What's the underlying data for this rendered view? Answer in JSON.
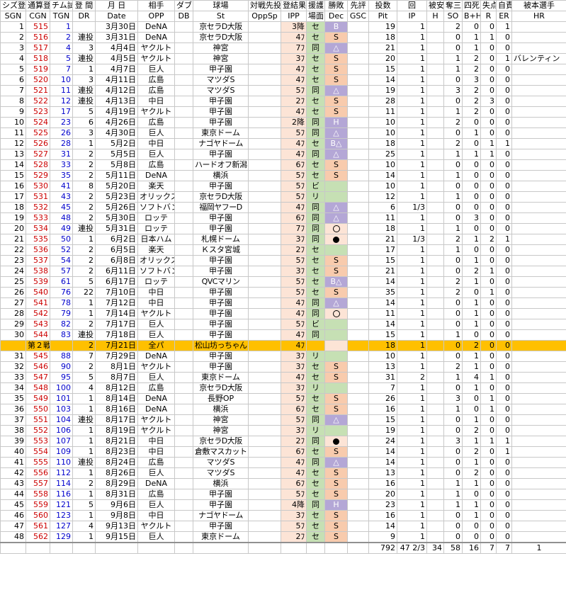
{
  "headers_jp": [
    "シズ登",
    "通算登",
    "チム試",
    "登 間",
    "月 日",
    "相手",
    "ダブル",
    "球場",
    "対戦先投",
    "登結果",
    "援護",
    "勝敗",
    "先評",
    "投数",
    "回",
    "被安",
    "奪三",
    "四死",
    "失点",
    "自責",
    "被本選手"
  ],
  "headers_en": [
    "SGN",
    "CGN",
    "TGN",
    "DR",
    "Date",
    "OPP",
    "DB",
    "St",
    "OppSp",
    "IPP",
    "場面",
    "Dec",
    "GSC",
    "Pit",
    "IP",
    "H",
    "SO",
    "B+H",
    "R",
    "ER",
    "HR"
  ],
  "rows": [
    {
      "sgn": "1",
      "cgn": "515",
      "tgn": "1",
      "dr": "",
      "date": "3月30日",
      "opp": "DeNA",
      "st": "京セラD大阪",
      "ipp": "3降",
      "scene": "セ",
      "dec": "B",
      "pit": "19",
      "ip": "1",
      "h": "",
      "so": "2",
      "bh": "0",
      "r": "0",
      "er": "1",
      "hr": ""
    },
    {
      "sgn": "2",
      "cgn": "516",
      "tgn": "2",
      "dr": "連投",
      "date": "3月31日",
      "opp": "DeNA",
      "st": "京セラD大阪",
      "ipp": "4ﾌ",
      "scene": "セ",
      "dec": "S",
      "pit": "18",
      "ip": "1",
      "h": "",
      "so": "0",
      "bh": "1",
      "r": "1",
      "er": "0",
      "hr": ""
    },
    {
      "sgn": "3",
      "cgn": "517",
      "tgn": "4",
      "dr": "3",
      "date": "4月4日",
      "opp": "ヤクルト",
      "st": "神宮",
      "ipp": "7ﾌ",
      "scene": "同",
      "dec": "△",
      "pit": "21",
      "ip": "1",
      "h": "",
      "so": "0",
      "bh": "1",
      "r": "0",
      "er": "0",
      "hr": ""
    },
    {
      "sgn": "4",
      "cgn": "518",
      "tgn": "5",
      "dr": "連投",
      "date": "4月5日",
      "opp": "ヤクルト",
      "st": "神宮",
      "ipp": "3ﾌ",
      "scene": "セ",
      "dec": "S",
      "pit": "20",
      "ip": "1",
      "h": "",
      "so": "1",
      "bh": "2",
      "r": "0",
      "er": "1",
      "hr": "バレンティン"
    },
    {
      "sgn": "5",
      "cgn": "519",
      "tgn": "7",
      "dr": "1",
      "date": "4月7日",
      "opp": "巨人",
      "st": "甲子園",
      "ipp": "4ﾌ",
      "scene": "セ",
      "dec": "S",
      "pit": "15",
      "ip": "1",
      "h": "",
      "so": "1",
      "bh": "2",
      "r": "0",
      "er": "0",
      "hr": ""
    },
    {
      "sgn": "6",
      "cgn": "520",
      "tgn": "10",
      "dr": "3",
      "date": "4月11日",
      "opp": "広島",
      "st": "マツダS",
      "ipp": "4ﾌ",
      "scene": "セ",
      "dec": "S",
      "pit": "14",
      "ip": "1",
      "h": "",
      "so": "0",
      "bh": "3",
      "r": "0",
      "er": "0",
      "hr": ""
    },
    {
      "sgn": "7",
      "cgn": "521",
      "tgn": "11",
      "dr": "連投",
      "date": "4月12日",
      "opp": "広島",
      "st": "マツダS",
      "ipp": "5ﾌ",
      "scene": "同",
      "dec": "△",
      "pit": "19",
      "ip": "1",
      "h": "",
      "so": "3",
      "bh": "2",
      "r": "0",
      "er": "0",
      "hr": ""
    },
    {
      "sgn": "8",
      "cgn": "522",
      "tgn": "12",
      "dr": "連投",
      "date": "4月13日",
      "opp": "中日",
      "st": "甲子園",
      "ipp": "2ﾌ",
      "scene": "セ",
      "dec": "S",
      "pit": "28",
      "ip": "1",
      "h": "",
      "so": "0",
      "bh": "2",
      "r": "3",
      "er": "0",
      "hr": ""
    },
    {
      "sgn": "9",
      "cgn": "523",
      "tgn": "17",
      "dr": "5",
      "date": "4月19日",
      "opp": "ヤクルト",
      "st": "甲子園",
      "ipp": "4ﾌ",
      "scene": "セ",
      "dec": "S",
      "pit": "11",
      "ip": "1",
      "h": "",
      "so": "1",
      "bh": "2",
      "r": "0",
      "er": "0",
      "hr": ""
    },
    {
      "sgn": "10",
      "cgn": "524",
      "tgn": "23",
      "dr": "6",
      "date": "4月26日",
      "opp": "広島",
      "st": "甲子園",
      "ipp": "2降",
      "scene": "同",
      "dec": "H",
      "pit": "10",
      "ip": "1",
      "h": "",
      "so": "2",
      "bh": "0",
      "r": "0",
      "er": "0",
      "hr": ""
    },
    {
      "sgn": "11",
      "cgn": "525",
      "tgn": "26",
      "dr": "3",
      "date": "4月30日",
      "opp": "巨人",
      "st": "東京ドーム",
      "ipp": "5ﾌ",
      "scene": "同",
      "dec": "△",
      "pit": "10",
      "ip": "1",
      "h": "",
      "so": "0",
      "bh": "1",
      "r": "0",
      "er": "0",
      "hr": ""
    },
    {
      "sgn": "12",
      "cgn": "526",
      "tgn": "28",
      "dr": "1",
      "date": "5月2日",
      "opp": "中日",
      "st": "ナゴヤドーム",
      "ipp": "4ﾌ",
      "scene": "セ",
      "dec": "B△",
      "pit": "18",
      "ip": "1",
      "h": "",
      "so": "2",
      "bh": "0",
      "r": "1",
      "er": "1",
      "hr": ""
    },
    {
      "sgn": "13",
      "cgn": "527",
      "tgn": "31",
      "dr": "2",
      "date": "5月5日",
      "opp": "巨人",
      "st": "甲子園",
      "ipp": "4ﾌ",
      "scene": "同",
      "dec": "△",
      "pit": "25",
      "ip": "1",
      "h": "",
      "so": "1",
      "bh": "1",
      "r": "1",
      "er": "0",
      "hr": ""
    },
    {
      "sgn": "14",
      "cgn": "528",
      "tgn": "33",
      "dr": "2",
      "date": "5月8日",
      "opp": "広島",
      "st": "ハードオフ新潟",
      "ipp": "6ﾌ",
      "scene": "セ",
      "dec": "S",
      "pit": "10",
      "ip": "1",
      "h": "",
      "so": "0",
      "bh": "0",
      "r": "0",
      "er": "0",
      "hr": ""
    },
    {
      "sgn": "15",
      "cgn": "529",
      "tgn": "35",
      "dr": "2",
      "date": "5月11日",
      "opp": "DeNA",
      "st": "横浜",
      "ipp": "5ﾌ",
      "scene": "セ",
      "dec": "S",
      "pit": "14",
      "ip": "1",
      "h": "",
      "so": "1",
      "bh": "0",
      "r": "0",
      "er": "0",
      "hr": ""
    },
    {
      "sgn": "16",
      "cgn": "530",
      "tgn": "41",
      "dr": "8",
      "date": "5月20日",
      "opp": "楽天",
      "st": "甲子園",
      "ipp": "5ﾌ",
      "scene": "ビ",
      "dec": "",
      "pit": "10",
      "ip": "1",
      "h": "",
      "so": "0",
      "bh": "0",
      "r": "0",
      "er": "0",
      "hr": ""
    },
    {
      "sgn": "17",
      "cgn": "531",
      "tgn": "43",
      "dr": "2",
      "date": "5月23日",
      "opp": "オリックス",
      "st": "京セラD大阪",
      "ipp": "5ﾌ",
      "scene": "リ",
      "dec": "",
      "pit": "12",
      "ip": "1",
      "h": "",
      "so": "1",
      "bh": "0",
      "r": "0",
      "er": "0",
      "hr": ""
    },
    {
      "sgn": "18",
      "cgn": "532",
      "tgn": "45",
      "dr": "2",
      "date": "5月26日",
      "opp": "ソフトバンク",
      "st": "福岡ヤフーD",
      "ipp": "4ﾌ",
      "scene": "同",
      "dec": "△",
      "pit": "6",
      "ip": "1/3",
      "h": "",
      "so": "0",
      "bh": "0",
      "r": "0",
      "er": "0",
      "hr": ""
    },
    {
      "sgn": "19",
      "cgn": "533",
      "tgn": "48",
      "dr": "2",
      "date": "5月30日",
      "opp": "ロッテ",
      "st": "甲子園",
      "ipp": "6ﾌ",
      "scene": "同",
      "dec": "△",
      "pit": "11",
      "ip": "1",
      "h": "",
      "so": "0",
      "bh": "3",
      "r": "0",
      "er": "0",
      "hr": ""
    },
    {
      "sgn": "20",
      "cgn": "534",
      "tgn": "49",
      "dr": "連投",
      "date": "5月31日",
      "opp": "ロッテ",
      "st": "甲子園",
      "ipp": "7ﾌ",
      "scene": "同",
      "dec": "○",
      "pit": "18",
      "ip": "1",
      "h": "",
      "so": "1",
      "bh": "0",
      "r": "0",
      "er": "0",
      "hr": ""
    },
    {
      "sgn": "21",
      "cgn": "535",
      "tgn": "50",
      "dr": "1",
      "date": "6月2日",
      "opp": "日本ハム",
      "st": "札幌ドーム",
      "ipp": "3ﾌ",
      "scene": "同",
      "dec": "●",
      "pit": "21",
      "ip": "1/3",
      "h": "",
      "so": "2",
      "bh": "1",
      "r": "2",
      "er": "1",
      "hr": ""
    },
    {
      "sgn": "22",
      "cgn": "536",
      "tgn": "52",
      "dr": "2",
      "date": "6月5日",
      "opp": "楽天",
      "st": "Ｋスタ宮城",
      "ipp": "2ﾌ",
      "scene": "セ",
      "dec": "",
      "pit": "17",
      "ip": "1",
      "h": "",
      "so": "1",
      "bh": "0",
      "r": "0",
      "er": "0",
      "hr": ""
    },
    {
      "sgn": "23",
      "cgn": "537",
      "tgn": "54",
      "dr": "2",
      "date": "6月8日",
      "opp": "オリックス",
      "st": "甲子園",
      "ipp": "5ﾌ",
      "scene": "セ",
      "dec": "S",
      "pit": "15",
      "ip": "1",
      "h": "",
      "so": "0",
      "bh": "1",
      "r": "0",
      "er": "0",
      "hr": ""
    },
    {
      "sgn": "24",
      "cgn": "538",
      "tgn": "57",
      "dr": "2",
      "date": "6月11日",
      "opp": "ソフトバンク",
      "st": "甲子園",
      "ipp": "3ﾌ",
      "scene": "セ",
      "dec": "S",
      "pit": "21",
      "ip": "1",
      "h": "",
      "so": "0",
      "bh": "2",
      "r": "1",
      "er": "0",
      "hr": ""
    },
    {
      "sgn": "25",
      "cgn": "539",
      "tgn": "61",
      "dr": "5",
      "date": "6月17日",
      "opp": "ロッテ",
      "st": "QVCマリン",
      "ipp": "5ﾌ",
      "scene": "セ",
      "dec": "B△",
      "pit": "14",
      "ip": "1",
      "h": "",
      "so": "2",
      "bh": "1",
      "r": "0",
      "er": "0",
      "hr": ""
    },
    {
      "sgn": "26",
      "cgn": "540",
      "tgn": "76",
      "dr": "22",
      "date": "7月10日",
      "opp": "中日",
      "st": "甲子園",
      "ipp": "5ﾌ",
      "scene": "セ",
      "dec": "S",
      "pit": "35",
      "ip": "1",
      "h": "",
      "so": "2",
      "bh": "0",
      "r": "1",
      "er": "0",
      "hr": ""
    },
    {
      "sgn": "27",
      "cgn": "541",
      "tgn": "78",
      "dr": "1",
      "date": "7月12日",
      "opp": "中日",
      "st": "甲子園",
      "ipp": "4ﾌ",
      "scene": "同",
      "dec": "△",
      "pit": "14",
      "ip": "1",
      "h": "",
      "so": "0",
      "bh": "1",
      "r": "0",
      "er": "0",
      "hr": ""
    },
    {
      "sgn": "28",
      "cgn": "542",
      "tgn": "79",
      "dr": "1",
      "date": "7月14日",
      "opp": "ヤクルト",
      "st": "甲子園",
      "ipp": "4ﾌ",
      "scene": "同",
      "dec": "○",
      "pit": "11",
      "ip": "1",
      "h": "",
      "so": "0",
      "bh": "1",
      "r": "0",
      "er": "0",
      "hr": ""
    },
    {
      "sgn": "29",
      "cgn": "543",
      "tgn": "82",
      "dr": "2",
      "date": "7月17日",
      "opp": "巨人",
      "st": "甲子園",
      "ipp": "5ﾌ",
      "scene": "ビ",
      "dec": "",
      "pit": "14",
      "ip": "1",
      "h": "",
      "so": "0",
      "bh": "1",
      "r": "0",
      "er": "0",
      "hr": ""
    },
    {
      "sgn": "30",
      "cgn": "544",
      "tgn": "83",
      "dr": "連投",
      "date": "7月18日",
      "opp": "巨人",
      "st": "甲子園",
      "ipp": "4ﾌ",
      "scene": "同",
      "dec": "",
      "pit": "15",
      "ip": "1",
      "h": "",
      "so": "1",
      "bh": "0",
      "r": "0",
      "er": "0",
      "hr": ""
    }
  ],
  "special_row": {
    "label": "第２戦",
    "tgn": "",
    "dr": "2",
    "date": "7月21日",
    "opp": "全パ",
    "st": "松山坊っちゃん",
    "ipp": "4ﾌ",
    "pit": "18",
    "ip": "1",
    "h": "",
    "so": "0",
    "bh": "2",
    "r": "0",
    "er": "0"
  },
  "rows2": [
    {
      "sgn": "31",
      "cgn": "545",
      "tgn": "88",
      "dr": "7",
      "date": "7月29日",
      "opp": "DeNA",
      "st": "甲子園",
      "ipp": "3ﾌ",
      "scene": "リ",
      "dec": "",
      "pit": "10",
      "ip": "1",
      "h": "",
      "so": "0",
      "bh": "1",
      "r": "0",
      "er": "0",
      "hr": ""
    },
    {
      "sgn": "32",
      "cgn": "546",
      "tgn": "90",
      "dr": "2",
      "date": "8月1日",
      "opp": "ヤクルト",
      "st": "甲子園",
      "ipp": "3ﾌ",
      "scene": "セ",
      "dec": "S",
      "pit": "13",
      "ip": "1",
      "h": "",
      "so": "2",
      "bh": "1",
      "r": "0",
      "er": "0",
      "hr": ""
    },
    {
      "sgn": "33",
      "cgn": "547",
      "tgn": "95",
      "dr": "5",
      "date": "8月7日",
      "opp": "巨人",
      "st": "東京ドーム",
      "ipp": "4ﾌ",
      "scene": "セ",
      "dec": "S",
      "pit": "31",
      "ip": "2",
      "h": "",
      "so": "1",
      "bh": "4",
      "r": "1",
      "er": "0",
      "hr": ""
    },
    {
      "sgn": "34",
      "cgn": "548",
      "tgn": "100",
      "dr": "4",
      "date": "8月12日",
      "opp": "広島",
      "st": "京セラD大阪",
      "ipp": "3ﾌ",
      "scene": "リ",
      "dec": "",
      "pit": "7",
      "ip": "1",
      "h": "",
      "so": "0",
      "bh": "1",
      "r": "0",
      "er": "0",
      "hr": ""
    },
    {
      "sgn": "35",
      "cgn": "549",
      "tgn": "101",
      "dr": "1",
      "date": "8月14日",
      "opp": "DeNA",
      "st": "長野OP",
      "ipp": "5ﾌ",
      "scene": "セ",
      "dec": "S",
      "pit": "26",
      "ip": "1",
      "h": "",
      "so": "3",
      "bh": "0",
      "r": "1",
      "er": "0",
      "hr": ""
    },
    {
      "sgn": "36",
      "cgn": "550",
      "tgn": "103",
      "dr": "1",
      "date": "8月16日",
      "opp": "DeNA",
      "st": "横浜",
      "ipp": "6ﾌ",
      "scene": "セ",
      "dec": "S",
      "pit": "16",
      "ip": "1",
      "h": "",
      "so": "1",
      "bh": "0",
      "r": "1",
      "er": "0",
      "hr": ""
    },
    {
      "sgn": "37",
      "cgn": "551",
      "tgn": "104",
      "dr": "連投",
      "date": "8月17日",
      "opp": "ヤクルト",
      "st": "神宮",
      "ipp": "5ﾌ",
      "scene": "同",
      "dec": "△",
      "pit": "15",
      "ip": "1",
      "h": "",
      "so": "0",
      "bh": "1",
      "r": "0",
      "er": "0",
      "hr": ""
    },
    {
      "sgn": "38",
      "cgn": "552",
      "tgn": "106",
      "dr": "1",
      "date": "8月19日",
      "opp": "ヤクルト",
      "st": "神宮",
      "ipp": "3ﾌ",
      "scene": "リ",
      "dec": "",
      "pit": "19",
      "ip": "1",
      "h": "",
      "so": "0",
      "bh": "2",
      "r": "0",
      "er": "0",
      "hr": ""
    },
    {
      "sgn": "39",
      "cgn": "553",
      "tgn": "107",
      "dr": "1",
      "date": "8月21日",
      "opp": "中日",
      "st": "京セラD大阪",
      "ipp": "2ﾌ",
      "scene": "同",
      "dec": "●",
      "pit": "24",
      "ip": "1",
      "h": "",
      "so": "3",
      "bh": "1",
      "r": "1",
      "er": "1",
      "hr": ""
    },
    {
      "sgn": "40",
      "cgn": "554",
      "tgn": "109",
      "dr": "1",
      "date": "8月23日",
      "opp": "中日",
      "st": "倉敷マスカット",
      "ipp": "6ﾌ",
      "scene": "セ",
      "dec": "S",
      "pit": "14",
      "ip": "1",
      "h": "",
      "so": "0",
      "bh": "2",
      "r": "0",
      "er": "1",
      "hr": ""
    },
    {
      "sgn": "41",
      "cgn": "555",
      "tgn": "110",
      "dr": "連投",
      "date": "8月24日",
      "opp": "広島",
      "st": "マツダS",
      "ipp": "4ﾌ",
      "scene": "同",
      "dec": "△",
      "pit": "14",
      "ip": "1",
      "h": "",
      "so": "0",
      "bh": "1",
      "r": "0",
      "er": "0",
      "hr": ""
    },
    {
      "sgn": "42",
      "cgn": "556",
      "tgn": "112",
      "dr": "1",
      "date": "8月26日",
      "opp": "巨人",
      "st": "マツダS",
      "ipp": "4ﾌ",
      "scene": "セ",
      "dec": "S",
      "pit": "13",
      "ip": "1",
      "h": "",
      "so": "0",
      "bh": "2",
      "r": "0",
      "er": "0",
      "hr": ""
    },
    {
      "sgn": "43",
      "cgn": "557",
      "tgn": "114",
      "dr": "2",
      "date": "8月29日",
      "opp": "DeNA",
      "st": "横浜",
      "ipp": "6ﾌ",
      "scene": "セ",
      "dec": "S",
      "pit": "16",
      "ip": "1",
      "h": "",
      "so": "1",
      "bh": "1",
      "r": "0",
      "er": "0",
      "hr": ""
    },
    {
      "sgn": "44",
      "cgn": "558",
      "tgn": "116",
      "dr": "1",
      "date": "8月31日",
      "opp": "広島",
      "st": "甲子園",
      "ipp": "5ﾌ",
      "scene": "セ",
      "dec": "S",
      "pit": "20",
      "ip": "1",
      "h": "",
      "so": "1",
      "bh": "0",
      "r": "0",
      "er": "0",
      "hr": ""
    },
    {
      "sgn": "45",
      "cgn": "559",
      "tgn": "121",
      "dr": "5",
      "date": "9月6日",
      "opp": "巨人",
      "st": "甲子園",
      "ipp": "4降",
      "scene": "同",
      "dec": "H",
      "pit": "23",
      "ip": "1",
      "h": "",
      "so": "1",
      "bh": "1",
      "r": "0",
      "er": "0",
      "hr": ""
    },
    {
      "sgn": "46",
      "cgn": "560",
      "tgn": "123",
      "dr": "1",
      "date": "9月8日",
      "opp": "中日",
      "st": "ナゴヤドーム",
      "ipp": "3ﾌ",
      "scene": "セ",
      "dec": "S",
      "pit": "16",
      "ip": "1",
      "h": "",
      "so": "0",
      "bh": "1",
      "r": "0",
      "er": "0",
      "hr": ""
    },
    {
      "sgn": "47",
      "cgn": "561",
      "tgn": "127",
      "dr": "4",
      "date": "9月13日",
      "opp": "ヤクルト",
      "st": "甲子園",
      "ipp": "5ﾌ",
      "scene": "セ",
      "dec": "S",
      "pit": "14",
      "ip": "1",
      "h": "",
      "so": "0",
      "bh": "0",
      "r": "0",
      "er": "0",
      "hr": ""
    },
    {
      "sgn": "48",
      "cgn": "562",
      "tgn": "129",
      "dr": "1",
      "date": "9月15日",
      "opp": "巨人",
      "st": "東京ドーム",
      "ipp": "2ﾌ",
      "scene": "セ",
      "dec": "S",
      "pit": "9",
      "ip": "1",
      "h": "",
      "so": "0",
      "bh": "0",
      "r": "0",
      "er": "0",
      "hr": ""
    }
  ],
  "totals": {
    "pit": "792",
    "ip": "47 2/3",
    "h": "34",
    "so": "58",
    "bh": "16",
    "r": "7",
    "er": "7",
    "hr": "1"
  },
  "colors": {
    "highlight_row": "#ffc000",
    "ipp_bg": "#fce4d6",
    "win_loss_green": "#c6e0b4",
    "purple": "#b4a7d6",
    "red_text": "#cc0000",
    "blue_text": "#0000cc"
  }
}
